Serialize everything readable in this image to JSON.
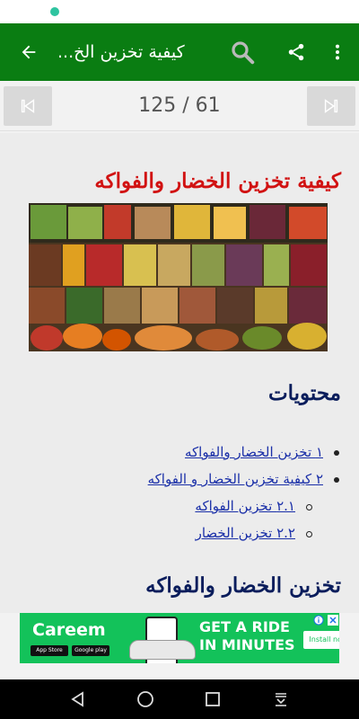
{
  "app_bar": {
    "title": "كيفية تخزين الخ...",
    "background": "#0a7d12"
  },
  "pager": {
    "indicator": "125 / 61"
  },
  "article": {
    "title": "كيفية تخزين الخضار والفواكه",
    "title_color": "#d11212",
    "toc_heading": "محتويات",
    "toc": [
      {
        "label": "١ تخزين الخضار والفواكه",
        "level": 1
      },
      {
        "label": "٢ كيفية تخزين الخضار و الفواكه",
        "level": 1
      },
      {
        "label": "٢.١ تخزين الفواكه",
        "level": 2
      },
      {
        "label": "٢.٢ تخزين الخضار",
        "level": 2
      }
    ],
    "section_heading": "تخزين الخضار والفواكه",
    "heading_color": "#0a1d5c"
  },
  "ad": {
    "brand": "Careem",
    "headline": "GET A RIDE IN MINUTES",
    "install": "Install now",
    "badges": [
      "App Store",
      "Google play"
    ],
    "background": "#13c25a"
  },
  "icons": {
    "back": "arrow-back-icon",
    "search": "search-icon",
    "share": "share-icon",
    "menu": "more-vert-icon",
    "first": "skip-previous-icon",
    "last": "skip-next-icon",
    "nav_back": "triangle-back-icon",
    "nav_home": "circle-home-icon",
    "nav_recent": "square-recent-icon",
    "nav_extra": "download-icon"
  }
}
